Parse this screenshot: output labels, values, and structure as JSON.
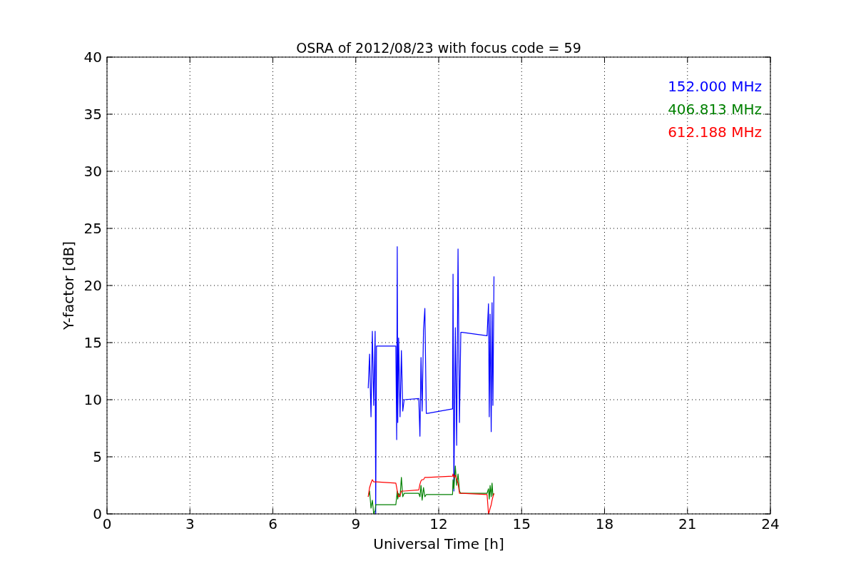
{
  "figure": {
    "chart_data": {
      "type": "line",
      "title": "OSRA of 2012/08/23 with focus code = 59",
      "xlabel": "Universal Time [h]",
      "ylabel": "Y-factor [dB]",
      "x": [
        9.45,
        9.5,
        9.55,
        9.6,
        9.65,
        9.7,
        9.72,
        9.75,
        10.45,
        10.48,
        10.5,
        10.52,
        10.55,
        10.6,
        10.65,
        10.7,
        10.75,
        11.28,
        11.32,
        11.36,
        11.4,
        11.45,
        11.5,
        11.55,
        11.6,
        12.5,
        12.52,
        12.55,
        12.6,
        12.65,
        12.7,
        12.75,
        12.8,
        12.85,
        13.75,
        13.8,
        13.83,
        13.86,
        13.9,
        13.93,
        13.96,
        14.0
      ],
      "series": [
        {
          "name": "152.000 MHz",
          "color": "#0000ff",
          "values": [
            11,
            14,
            8.5,
            16,
            9.5,
            16,
            0,
            14.7,
            14.7,
            6.5,
            23.4,
            8,
            15.4,
            8.5,
            14.3,
            9,
            10,
            10.1,
            6.8,
            13.7,
            9,
            16.1,
            18,
            8.8,
            8.8,
            9.2,
            21,
            2,
            16.3,
            6,
            23.2,
            8,
            15.9,
            15.9,
            15.6,
            18.4,
            8.5,
            17.5,
            7.2,
            18.5,
            9.5,
            20.8
          ]
        },
        {
          "name": "406.813 MHz",
          "color": "#008000",
          "values": [
            1.5,
            2,
            0.5,
            1.2,
            0,
            0.3,
            0.8,
            0.8,
            0.8,
            1.5,
            2,
            1.3,
            1.8,
            1.5,
            3.2,
            1.5,
            1.8,
            1.8,
            1.5,
            2.5,
            1.2,
            2.3,
            1.5,
            1.7,
            1.7,
            1.7,
            3,
            2.2,
            4.2,
            2.5,
            3.5,
            2,
            1.8,
            1.8,
            1.8,
            2.2,
            1.3,
            2.5,
            1.5,
            2.7,
            1.6,
            1.8
          ]
        },
        {
          "name": "612.188 MHz",
          "color": "#ff0000",
          "values": [
            1.5,
            2.3,
            2.7,
            3,
            2.8,
            2.8,
            2.8,
            2.8,
            2.7,
            2.3,
            2,
            1.8,
            1.5,
            1.6,
            2,
            2,
            2,
            2.1,
            2.6,
            2.9,
            3,
            3,
            3.2,
            3.2,
            3.2,
            3.3,
            3.5,
            3.2,
            3.4,
            3,
            2.7,
            1.8,
            1.8,
            1.8,
            1.7,
            0,
            0.2,
            0.5,
            0.8,
            1.2,
            1.5,
            1.8
          ]
        }
      ],
      "grid": true,
      "xlim": [
        0,
        24
      ],
      "ylim": [
        0,
        40
      ],
      "xticks": [
        0,
        3,
        6,
        9,
        12,
        15,
        18,
        21,
        24
      ],
      "yticks": [
        0,
        5,
        10,
        15,
        20,
        25,
        30,
        35,
        40
      ]
    }
  }
}
